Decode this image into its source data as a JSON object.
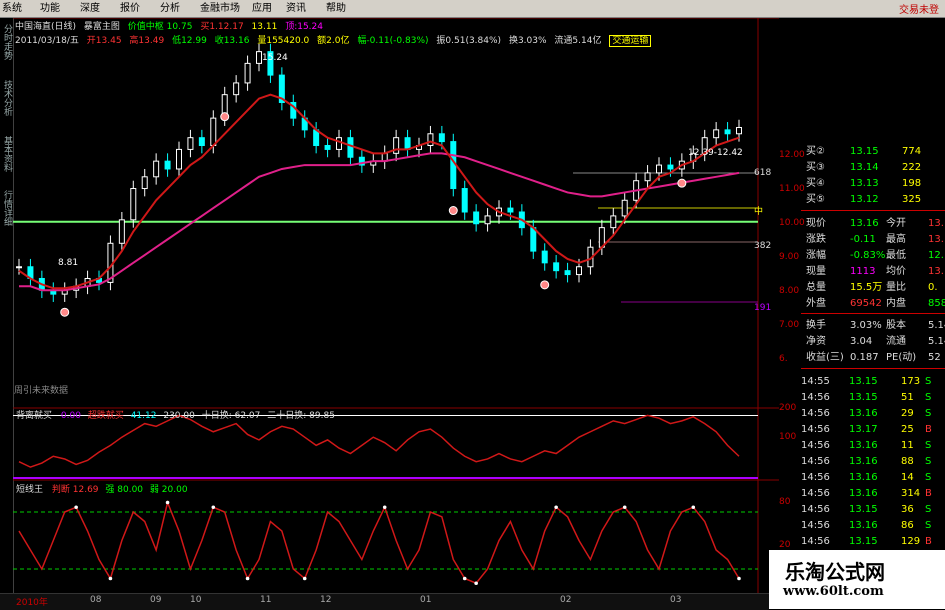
{
  "menu": {
    "items": [
      "系统",
      "功能",
      "深度",
      "报价",
      "分析",
      "金融市场",
      "应用",
      "资讯",
      "帮助"
    ],
    "right": "交易未登"
  },
  "left_tabs": [
    "分时走势",
    "技术分析",
    "基本资料",
    "行情详细"
  ],
  "info": {
    "title": "中国海直(日线)",
    "formula": "暴富主图",
    "price_center": "价值中枢 10.75",
    "buy": "买1.12.17",
    "sell": "13.11",
    "top": "顶:15.24",
    "date": "2011/03/18/五",
    "open": "开13.45",
    "high": "高13.49",
    "low": "低12.99",
    "close": "收13.16",
    "volume": "量155420.0",
    "amount": "额2.0亿",
    "change": "幅-0.11(-0.83%)",
    "amplitude": "振0.51(3.84%)",
    "turnover": "换3.03%",
    "float": "流通5.14亿",
    "sector": "交通运输"
  },
  "main_chart": {
    "high_label": "15.24",
    "low_label": "8.81",
    "range_label": "12.39-12.42",
    "fib_labels": [
      "618",
      "中",
      "382",
      "191"
    ],
    "axis": [
      "12.00",
      "11.00",
      "10.00",
      "9.00",
      "8.00",
      "7.00",
      "6."
    ],
    "caption": "周引未来数据"
  },
  "indicator1": {
    "name": "背离就买",
    "v1": "0.00",
    "v2": "超跌就买",
    "v3": "41.12",
    "v4": "230.00",
    "v5": "十日换: 62.07",
    "v6": "二十日换: 89.85",
    "axis": [
      "200",
      "100"
    ]
  },
  "indicator2": {
    "name": "短线王",
    "v1": "判断 12.69",
    "v2": "强 80.00",
    "v3": "弱 20.00",
    "axis": [
      "80",
      "20"
    ]
  },
  "bottom": {
    "date": "2010年",
    "ticks": [
      "08",
      "09",
      "10",
      "11",
      "12",
      "01",
      "02",
      "03"
    ]
  },
  "quote_panel": {
    "bids": [
      {
        "label": "买②",
        "price": "13.15",
        "vol": "774"
      },
      {
        "label": "买③",
        "price": "13.14",
        "vol": "222"
      },
      {
        "label": "买④",
        "price": "13.13",
        "vol": "198"
      },
      {
        "label": "买⑤",
        "price": "13.12",
        "vol": "325"
      }
    ],
    "stats": [
      {
        "k1": "现价",
        "v1": "13.16",
        "k2": "今开",
        "v2": "13."
      },
      {
        "k1": "涨跌",
        "v1": "-0.11",
        "k2": "最高",
        "v2": "13."
      },
      {
        "k1": "涨幅",
        "v1": "-0.83%",
        "k2": "最低",
        "v2": "12."
      },
      {
        "k1": "现量",
        "v1": "1113",
        "k2": "均价",
        "v2": "13."
      },
      {
        "k1": "总量",
        "v1": "15.5万",
        "k2": "量比",
        "v2": "0."
      },
      {
        "k1": "外盘",
        "v1": "69542",
        "k2": "内盘",
        "v2": "858"
      },
      {
        "k1": "换手",
        "v1": "3.03%",
        "k2": "股本",
        "v2": "5.14"
      },
      {
        "k1": "净资",
        "v1": "3.04",
        "k2": "流通",
        "v2": "5.14"
      },
      {
        "k1": "收益(三)",
        "v1": "0.187",
        "k2": "PE(动)",
        "v2": "52"
      }
    ],
    "ticks": [
      {
        "t": "14:55",
        "p": "13.15",
        "v": "173",
        "s": "S"
      },
      {
        "t": "14:56",
        "p": "13.15",
        "v": "51",
        "s": "S"
      },
      {
        "t": "14:56",
        "p": "13.16",
        "v": "29",
        "s": "S"
      },
      {
        "t": "14:56",
        "p": "13.17",
        "v": "25",
        "s": "B"
      },
      {
        "t": "14:56",
        "p": "13.16",
        "v": "11",
        "s": "S"
      },
      {
        "t": "14:56",
        "p": "13.16",
        "v": "88",
        "s": "S"
      },
      {
        "t": "14:56",
        "p": "13.16",
        "v": "14",
        "s": "S"
      },
      {
        "t": "14:56",
        "p": "13.16",
        "v": "314",
        "s": "B"
      },
      {
        "t": "14:56",
        "p": "13.15",
        "v": "36",
        "s": "S"
      },
      {
        "t": "14:56",
        "p": "13.16",
        "v": "86",
        "s": "S"
      },
      {
        "t": "14:56",
        "p": "13.15",
        "v": "129",
        "s": "B"
      }
    ]
  },
  "watermark": {
    "title": "乐淘公式网",
    "url": "www.60lt.com"
  },
  "chart_data": [
    {
      "type": "candlestick",
      "title": "中国海直(日线)",
      "closes": [
        9.6,
        9.3,
        9.0,
        8.9,
        9.0,
        9.1,
        9.3,
        9.2,
        10.2,
        10.8,
        11.6,
        11.9,
        12.3,
        12.1,
        12.6,
        12.9,
        12.7,
        13.4,
        14.0,
        14.3,
        14.8,
        15.1,
        14.5,
        13.8,
        13.4,
        13.1,
        12.7,
        12.6,
        12.9,
        12.4,
        12.2,
        12.3,
        12.5,
        12.9,
        12.6,
        12.7,
        13.0,
        12.8,
        11.6,
        11.0,
        10.7,
        10.9,
        11.1,
        11.0,
        10.6,
        10.0,
        9.7,
        9.5,
        9.4,
        9.6,
        10.1,
        10.6,
        10.9,
        11.3,
        11.8,
        12.0,
        12.2,
        12.1,
        12.3,
        12.5,
        12.9,
        13.1,
        13.0,
        13.16
      ],
      "ma_short": [
        9.5,
        9.3,
        9.15,
        9.05,
        9.05,
        9.1,
        9.2,
        9.3,
        9.6,
        10.0,
        10.5,
        10.9,
        11.3,
        11.6,
        11.9,
        12.2,
        12.4,
        12.7,
        13.0,
        13.3,
        13.6,
        13.9,
        14.0,
        13.9,
        13.7,
        13.4,
        13.1,
        12.9,
        12.8,
        12.7,
        12.6,
        12.5,
        12.5,
        12.6,
        12.6,
        12.7,
        12.8,
        12.7,
        12.3,
        11.9,
        11.5,
        11.2,
        11.0,
        10.9,
        10.8,
        10.6,
        10.3,
        10.0,
        9.8,
        9.7,
        9.8,
        10.1,
        10.4,
        10.8,
        11.2,
        11.6,
        11.9,
        12.0,
        12.2,
        12.3,
        12.5,
        12.7,
        12.8,
        12.9
      ],
      "ma_long": [
        9.1,
        9.1,
        9.0,
        9.0,
        9.0,
        9.05,
        9.1,
        9.15,
        9.3,
        9.5,
        9.7,
        9.9,
        10.1,
        10.3,
        10.5,
        10.7,
        10.9,
        11.1,
        11.3,
        11.5,
        11.7,
        11.9,
        12.0,
        12.1,
        12.15,
        12.2,
        12.2,
        12.2,
        12.2,
        12.2,
        12.25,
        12.3,
        12.3,
        12.35,
        12.4,
        12.45,
        12.5,
        12.5,
        12.45,
        12.4,
        12.3,
        12.2,
        12.1,
        12.0,
        11.9,
        11.8,
        11.7,
        11.6,
        11.5,
        11.45,
        11.4,
        11.4,
        11.45,
        11.5,
        11.55,
        11.6,
        11.65,
        11.7,
        11.75,
        11.8,
        11.85,
        11.9,
        11.95,
        12.0
      ],
      "value_center": 10.75,
      "ylim": [
        6.5,
        15.5
      ]
    },
    {
      "type": "line",
      "title": "背离就买",
      "values": [
        60,
        40,
        55,
        80,
        70,
        50,
        65,
        95,
        120,
        150,
        175,
        200,
        190,
        210,
        230,
        215,
        190,
        170,
        185,
        200,
        160,
        140,
        170,
        190,
        180,
        150,
        120,
        140,
        110,
        90,
        120,
        150,
        130,
        100,
        140,
        170,
        180,
        150,
        110,
        80,
        60,
        70,
        90,
        70,
        60,
        80,
        100,
        90,
        120,
        150,
        170,
        190,
        210,
        200,
        215,
        230,
        220,
        200,
        210,
        225,
        200,
        170,
        120,
        80
      ],
      "ylim": [
        0,
        250
      ],
      "lines": [
        230,
        0
      ]
    },
    {
      "type": "line",
      "title": "短线王",
      "values": [
        60,
        40,
        20,
        50,
        80,
        85,
        60,
        30,
        10,
        50,
        80,
        70,
        40,
        90,
        60,
        20,
        50,
        85,
        80,
        40,
        10,
        30,
        70,
        60,
        20,
        10,
        40,
        80,
        70,
        50,
        30,
        60,
        85,
        50,
        20,
        40,
        80,
        75,
        30,
        10,
        5,
        20,
        50,
        70,
        40,
        20,
        60,
        85,
        75,
        50,
        30,
        60,
        80,
        85,
        70,
        40,
        20,
        60,
        80,
        85,
        70,
        40,
        30,
        10
      ],
      "ylim": [
        0,
        100
      ],
      "lines": [
        80,
        20
      ]
    }
  ]
}
